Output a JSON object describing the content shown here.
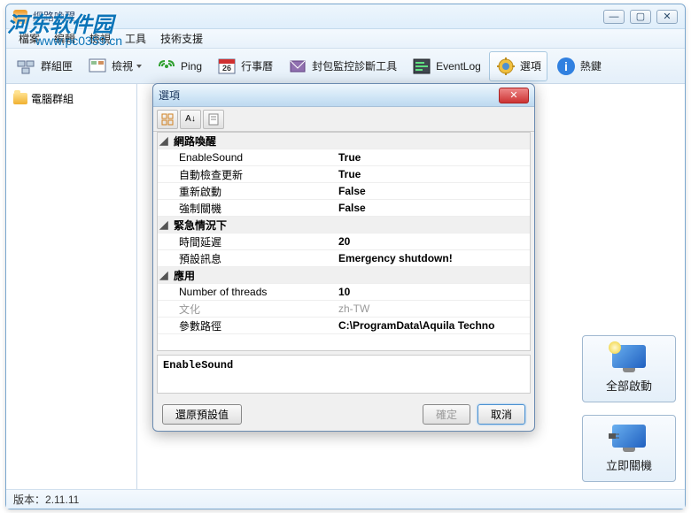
{
  "watermark": {
    "text": "河东软件园",
    "url": "www.pc0359.cn"
  },
  "window": {
    "title": "網路喚醒",
    "min": "—",
    "max": "▢",
    "close": "✕"
  },
  "menu": {
    "file": "檔案",
    "edit": "編輯",
    "view": "檢視",
    "tools": "工具",
    "support": "技術支援"
  },
  "toolbar": {
    "groupbox": "群組匣",
    "view": "檢視",
    "ping": "Ping",
    "calendar": "行事曆",
    "calendar_day": "26",
    "packet": "封包監控診斷工具",
    "eventlog": "EventLog",
    "options": "選項",
    "hotkey": "熱鍵"
  },
  "tree": {
    "root": "電腦群組"
  },
  "sidebuttons": {
    "startall": "全部啟動",
    "shutdown": "立即關機"
  },
  "status": {
    "version_label": "版本：",
    "version": "2.11.11"
  },
  "dialog": {
    "title": "選項",
    "groups": [
      {
        "name": "網路喚醒",
        "rows": [
          {
            "k": "EnableSound",
            "v": "True"
          },
          {
            "k": "自動檢查更新",
            "v": "True"
          },
          {
            "k": "重新啟動",
            "v": "False"
          },
          {
            "k": "強制關機",
            "v": "False"
          }
        ]
      },
      {
        "name": "緊急情況下",
        "rows": [
          {
            "k": "時間延遲",
            "v": "20"
          },
          {
            "k": "預設訊息",
            "v": "Emergency shutdown!"
          }
        ]
      },
      {
        "name": "應用",
        "rows": [
          {
            "k": "Number of threads",
            "v": "10"
          },
          {
            "k": "文化",
            "v": "zh-TW",
            "disabled": true
          },
          {
            "k": "參數路徑",
            "v": "C:\\ProgramData\\Aquila Techno"
          }
        ]
      }
    ],
    "selected_desc": "EnableSound",
    "btn_restore": "還原預設值",
    "btn_ok": "確定",
    "btn_cancel": "取消"
  }
}
